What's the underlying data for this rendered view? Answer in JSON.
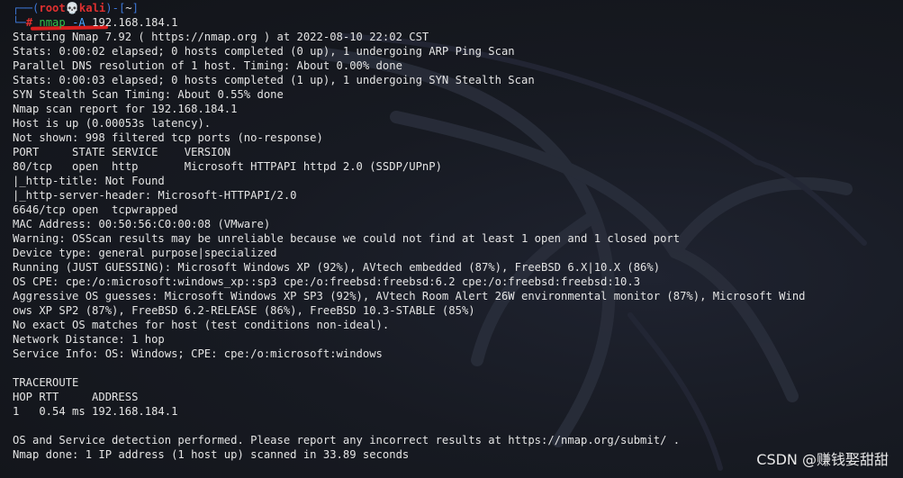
{
  "prompt": {
    "corner_top": "┌──(",
    "user": "root",
    "skull": "💀",
    "host": "kali",
    "mid": ")-[",
    "cwd": "~",
    "close": "]",
    "corner_bottom": "└─",
    "hash": "#",
    "command": "nmap",
    "flag": "-A",
    "target": "192.168.184.1"
  },
  "output_lines": [
    "Starting Nmap 7.92 ( https://nmap.org ) at 2022-08-10 22:02 CST",
    "Stats: 0:00:02 elapsed; 0 hosts completed (0 up), 1 undergoing ARP Ping Scan",
    "Parallel DNS resolution of 1 host. Timing: About 0.00% done",
    "Stats: 0:00:03 elapsed; 0 hosts completed (1 up), 1 undergoing SYN Stealth Scan",
    "SYN Stealth Scan Timing: About 0.55% done",
    "Nmap scan report for 192.168.184.1",
    "Host is up (0.00053s latency).",
    "Not shown: 998 filtered tcp ports (no-response)",
    "PORT     STATE SERVICE    VERSION",
    "80/tcp   open  http       Microsoft HTTPAPI httpd 2.0 (SSDP/UPnP)",
    "|_http-title: Not Found",
    "|_http-server-header: Microsoft-HTTPAPI/2.0",
    "6646/tcp open  tcpwrapped",
    "MAC Address: 00:50:56:C0:00:08 (VMware)",
    "Warning: OSScan results may be unreliable because we could not find at least 1 open and 1 closed port",
    "Device type: general purpose|specialized",
    "Running (JUST GUESSING): Microsoft Windows XP (92%), AVtech embedded (87%), FreeBSD 6.X|10.X (86%)",
    "OS CPE: cpe:/o:microsoft:windows_xp::sp3 cpe:/o:freebsd:freebsd:6.2 cpe:/o:freebsd:freebsd:10.3",
    "Aggressive OS guesses: Microsoft Windows XP SP3 (92%), AVtech Room Alert 26W environmental monitor (87%), Microsoft Wind",
    "ows XP SP2 (87%), FreeBSD 6.2-RELEASE (86%), FreeBSD 10.3-STABLE (85%)",
    "No exact OS matches for host (test conditions non-ideal).",
    "Network Distance: 1 hop",
    "Service Info: OS: Windows; CPE: cpe:/o:microsoft:windows",
    "",
    "TRACEROUTE",
    "HOP RTT     ADDRESS",
    "1   0.54 ms 192.168.184.1",
    "",
    "OS and Service detection performed. Please report any incorrect results at https://nmap.org/submit/ .",
    "Nmap done: 1 IP address (1 host up) scanned in 33.89 seconds"
  ],
  "watermark": "CSDN @赚钱娶甜甜",
  "colors": {
    "prompt_frame": "#3d78d8",
    "prompt_user": "#e03030",
    "command": "#33c24a",
    "flag": "#4aa3ff",
    "annotation_underline": "#d81e1e",
    "text": "#e4e4e4"
  }
}
